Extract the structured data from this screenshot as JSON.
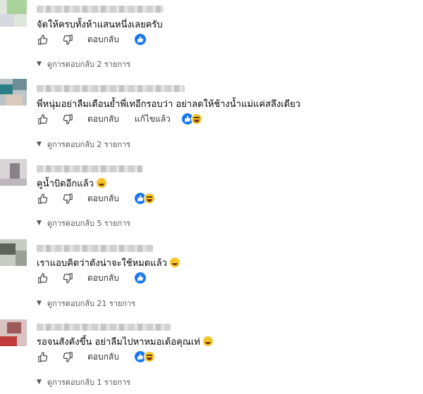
{
  "actions": {
    "reply_label": "ตอบกลับ",
    "edited_label": "แก้ไขแล้ว"
  },
  "comments": [
    {
      "text": "จัดให้ครบทั้งห้าแสนหนึ่งเลยครับ",
      "reactions": [
        "like"
      ],
      "replies": "ดูการตอบกลับ 2 รายการ",
      "edited": false,
      "text_emoji": ""
    },
    {
      "text": "พี่หนุ่มอย่าลืมเตือนย้ำพี่เทอีกรอบว่า อย่าลดให้ช้างน้ำแม่แค่สลึงเดียว",
      "reactions": [
        "like",
        "haha"
      ],
      "replies": "ดูการตอบกลับ 2 รายการ",
      "edited": true,
      "text_emoji": ""
    },
    {
      "text": "คูน้ำบิดอีกแล้ว",
      "reactions": [
        "like",
        "haha"
      ],
      "replies": "ดูการตอบกลับ 5 รายการ",
      "edited": false,
      "text_emoji": "rofl"
    },
    {
      "text": "เราแอบคิดว่าตังน่าจะใช้หมดแล้ว",
      "reactions": [
        "like"
      ],
      "replies": "ดูการตอบกลับ 21 รายการ",
      "edited": false,
      "text_emoji": "laugh"
    },
    {
      "text": "รอจนสังคังขึ้น อย่าลืมไปหาหมอเด้อคุณเท่",
      "reactions": [
        "like",
        "haha"
      ],
      "replies": "ดูการตอบกลับ 1 รายการ",
      "edited": false,
      "text_emoji": "rofl"
    }
  ]
}
